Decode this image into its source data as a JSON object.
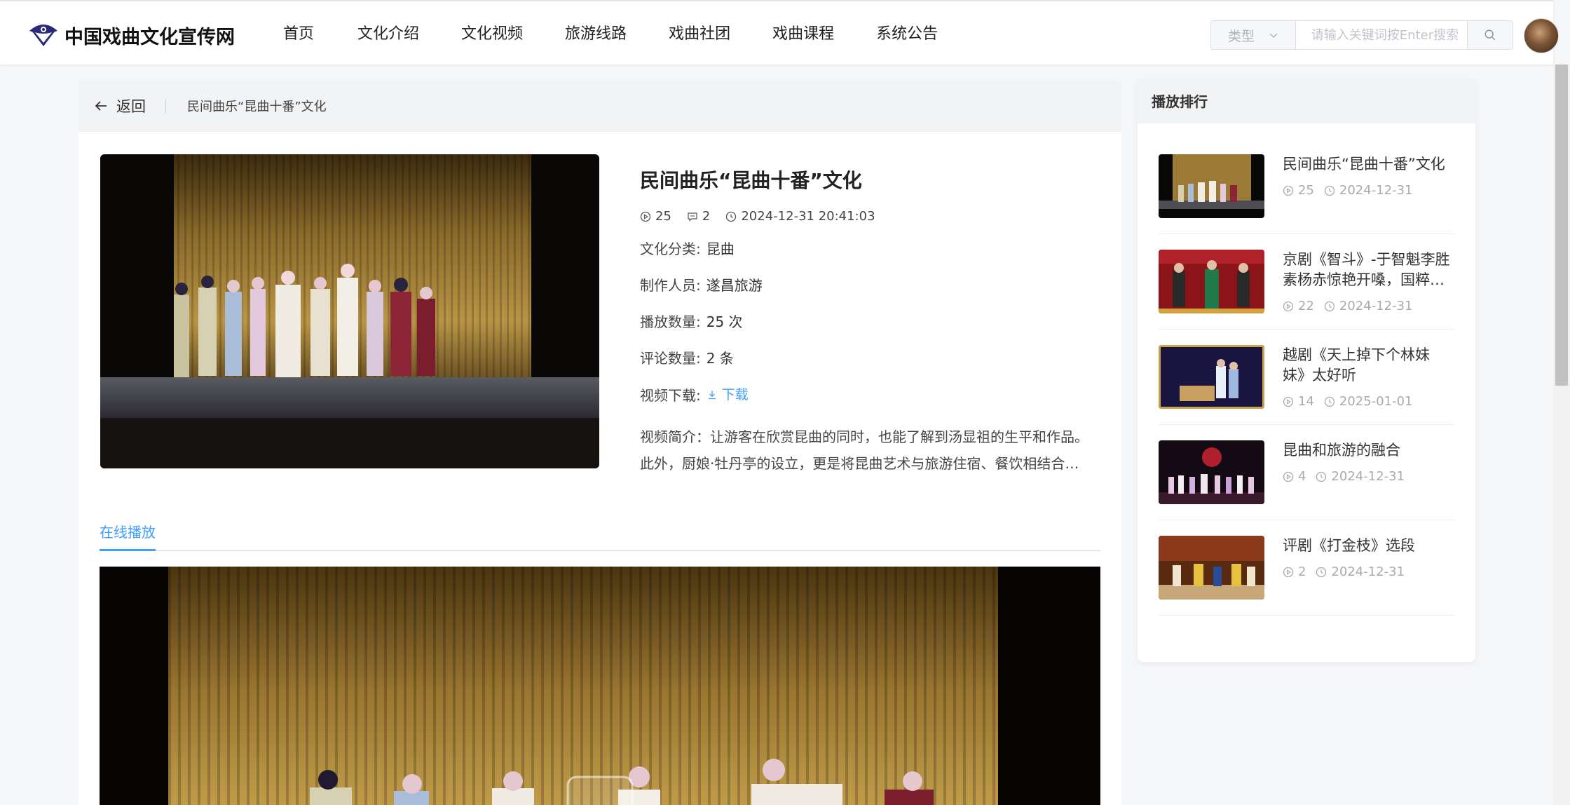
{
  "header": {
    "site_name": "中国戏曲文化宣传网",
    "nav": [
      "首页",
      "文化介绍",
      "文化视频",
      "旅游线路",
      "戏曲社团",
      "戏曲课程",
      "系统公告"
    ],
    "search": {
      "type_label": "类型",
      "placeholder": "请输入关键词按Enter搜索",
      "value": ""
    }
  },
  "breadcrumb": {
    "back_label": "返回",
    "title": "民间曲乐“昆曲十番”文化"
  },
  "video": {
    "title": "民间曲乐“昆曲十番”文化",
    "plays": "25",
    "comments": "2",
    "datetime": "2024-12-31 20:41:03",
    "category_label": "文化分类:",
    "category": "昆曲",
    "producer_label": "制作人员:",
    "producer": "遂昌旅游",
    "play_count_label": "播放数量:",
    "play_count": "25 次",
    "comment_count_label": "评论数量:",
    "comment_count": "2 条",
    "download_label": "视频下载:",
    "download_link": "下载",
    "description": "视频简介：让游客在欣赏昆曲的同时，也能了解到汤显祖的生平和作品。此外，厨娘·牡丹亭的设立，更是将昆曲艺术与旅游住宿、餐饮相结合，为游客提供了别具一格的文化体验。"
  },
  "tabs": [
    "在线播放"
  ],
  "ranking": {
    "title": "播放排行",
    "items": [
      {
        "title": "民间曲乐“昆曲十番”文化",
        "plays": "25",
        "date": "2024-12-31"
      },
      {
        "title": "京剧《智斗》-于智魁李胜素杨赤惊艳开嗓，国粹经典",
        "plays": "22",
        "date": "2024-12-31"
      },
      {
        "title": "越剧《天上掉下个林妹妹》太好听",
        "plays": "14",
        "date": "2025-01-01"
      },
      {
        "title": "昆曲和旅游的融合",
        "plays": "4",
        "date": "2024-12-31"
      },
      {
        "title": "评剧《打金枝》选段",
        "plays": "2",
        "date": "2024-12-31"
      }
    ]
  },
  "colors": {
    "accent": "#409eff",
    "brand": "#2b2a7a"
  }
}
